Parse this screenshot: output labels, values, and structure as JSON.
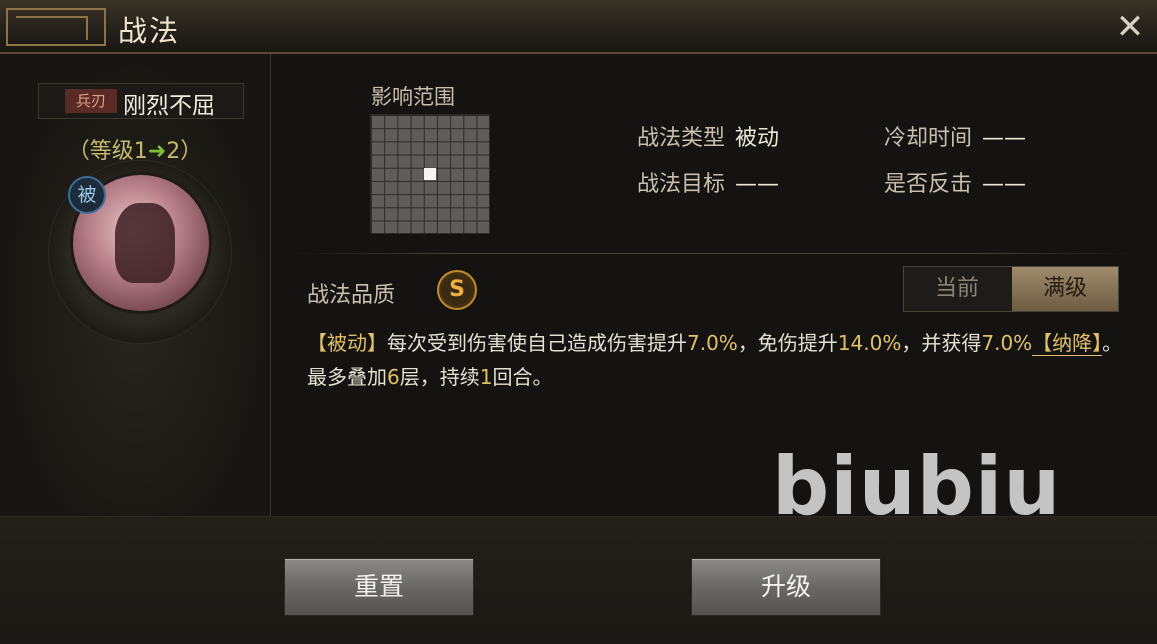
{
  "window": {
    "title": "战法",
    "close_icon": "close-icon"
  },
  "skill": {
    "type_tag": "兵刃",
    "name": "刚烈不屈",
    "level_prefix": "（等级1",
    "level_arrow": "➜",
    "level_suffix": "2）",
    "passive_badge": "被"
  },
  "range": {
    "label": "影响范围",
    "grid_size": 9
  },
  "stats": {
    "type_label": "战法类型",
    "type_value": "被动",
    "cooldown_label": "冷却时间",
    "cooldown_value": "——",
    "target_label": "战法目标",
    "target_value": "——",
    "counter_label": "是否反击",
    "counter_value": "——"
  },
  "quality": {
    "label": "战法品质",
    "grade": "S"
  },
  "toggle": {
    "current": "当前",
    "max": "满级",
    "selected": "max"
  },
  "description": {
    "tag": "【被动】",
    "part1": "每次受到伤害使自己造成伤害提升",
    "num1": "7.0%",
    "part2": "，免伤提升",
    "num2": "14.0%",
    "part3": "，并获得",
    "num3": "7.0%",
    "link": "【纳降】",
    "part4": "。最多叠加",
    "num4": "6",
    "part5": "层，持续",
    "num5": "1",
    "part6": "回合。"
  },
  "watermark": "biubiu",
  "buttons": {
    "reset": "重置",
    "upgrade": "升级"
  },
  "colors": {
    "accent_gold": "#e2c06a",
    "level_green": "#7ec23a",
    "passive_blue": "#3b6f95"
  }
}
